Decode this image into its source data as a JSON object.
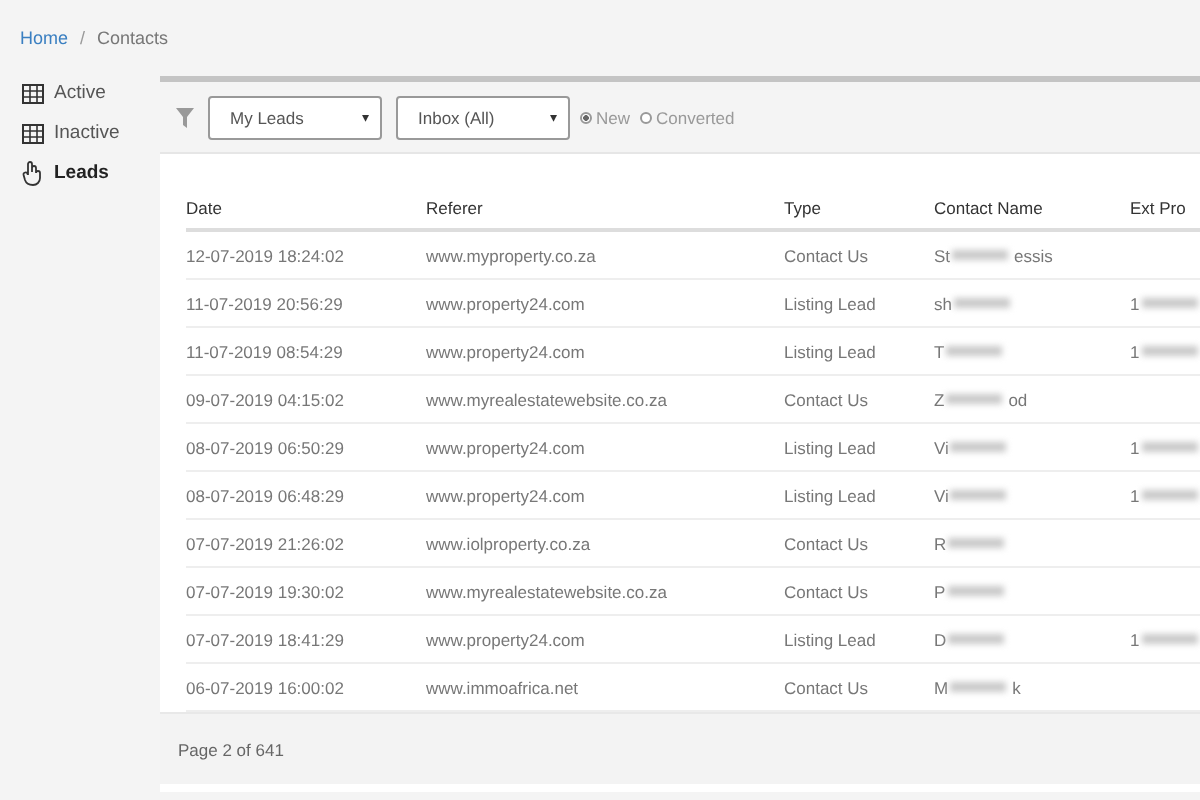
{
  "breadcrumb": [
    {
      "label": "Home",
      "link": true
    },
    {
      "label": "Contacts",
      "link": false
    }
  ],
  "breadcrumb_separator": "/",
  "sidebar": {
    "items": [
      {
        "label": "Active",
        "kind": "table",
        "selected": false
      },
      {
        "label": "Inactive",
        "kind": "table",
        "selected": false
      },
      {
        "label": "Leads",
        "kind": "hand",
        "selected": true
      }
    ]
  },
  "filters": {
    "selects": [
      {
        "value": "My Leads",
        "caret": "▾"
      },
      {
        "value": "Inbox (All)",
        "caret": "▾"
      }
    ],
    "radios": [
      {
        "label": "New",
        "selected": true
      },
      {
        "label": "Converted",
        "selected": false
      }
    ]
  },
  "table": {
    "columns": [
      "Date",
      "Referer",
      "Type",
      "Contact Name",
      "Ext Pro"
    ],
    "rows": [
      {
        "date": "12-07-2019 18:24:02",
        "referer": "www.myproperty.co.za",
        "type": "Contact Us",
        "contact_start": "St",
        "contact_end": "essis",
        "ext": ""
      },
      {
        "date": "11-07-2019 20:56:29",
        "referer": "www.property24.com",
        "type": "Listing Lead",
        "contact_start": "sh",
        "contact_end": "",
        "ext": "1"
      },
      {
        "date": "11-07-2019 08:54:29",
        "referer": "www.property24.com",
        "type": "Listing Lead",
        "contact_start": "T",
        "contact_end": "",
        "ext": "1"
      },
      {
        "date": "09-07-2019 04:15:02",
        "referer": "www.myrealestatewebsite.co.za",
        "type": "Contact Us",
        "contact_start": "Z",
        "contact_end": "od",
        "ext": ""
      },
      {
        "date": "08-07-2019 06:50:29",
        "referer": "www.property24.com",
        "type": "Listing Lead",
        "contact_start": "Vi",
        "contact_end": "",
        "ext": "1"
      },
      {
        "date": "08-07-2019 06:48:29",
        "referer": "www.property24.com",
        "type": "Listing Lead",
        "contact_start": "Vi",
        "contact_end": "",
        "ext": "1"
      },
      {
        "date": "07-07-2019 21:26:02",
        "referer": "www.iolproperty.co.za",
        "type": "Contact Us",
        "contact_start": "R",
        "contact_end": "",
        "ext": ""
      },
      {
        "date": "07-07-2019 19:30:02",
        "referer": "www.myrealestatewebsite.co.za",
        "type": "Contact Us",
        "contact_start": "P",
        "contact_end": "",
        "ext": ""
      },
      {
        "date": "07-07-2019 18:41:29",
        "referer": "www.property24.com",
        "type": "Listing Lead",
        "contact_start": "D",
        "contact_end": "",
        "ext": "1"
      },
      {
        "date": "06-07-2019 16:00:02",
        "referer": "www.immoafrica.net",
        "type": "Contact Us",
        "contact_start": "M",
        "contact_end": "k",
        "ext": ""
      }
    ]
  },
  "footer": {
    "pagination": "Page 2 of 641"
  }
}
